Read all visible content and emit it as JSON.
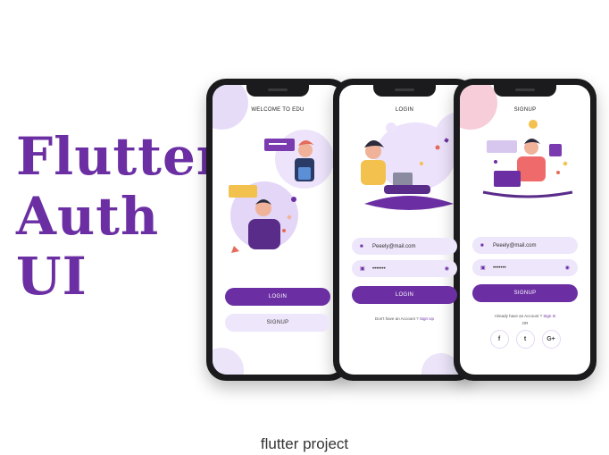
{
  "headline": {
    "line1": "Flutter",
    "line2": "Auth",
    "line3": "UI"
  },
  "caption": "flutter project",
  "welcome_screen": {
    "title": "WELCOME TO EDU",
    "login_label": "LOGIN",
    "signup_label": "SIGNUP"
  },
  "login_screen": {
    "title": "LOGIN",
    "email_value": "Peeely@mail.com",
    "password_value": "•••••••",
    "login_label": "LOGIN",
    "footer_text": "Don't have an Account ?",
    "footer_link": "Sign Up"
  },
  "signup_screen": {
    "title": "SIGNUP",
    "email_value": "Peeely@mail.com",
    "password_value": "•••••••",
    "signup_label": "SIGNUP",
    "footer_text": "Already have an Account ?",
    "footer_link": "Sign In",
    "or_label": "OR",
    "social": [
      "f",
      "t",
      "G+"
    ]
  },
  "icons": {
    "user": "user-icon",
    "lock": "lock-icon",
    "eye": "eye-icon",
    "facebook": "facebook-icon",
    "twitter": "twitter-icon",
    "google": "google-plus-icon"
  },
  "colors": {
    "brand_purple": "#6b2fa3",
    "field_bg": "#eee6fa",
    "phone_frame": "#1b1b1d"
  }
}
